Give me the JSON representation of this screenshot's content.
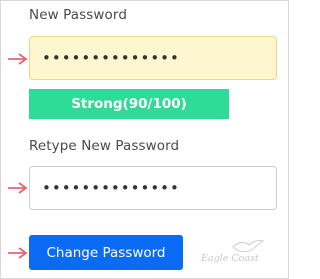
{
  "form": {
    "new_password_label": "New Password",
    "new_password_value": "••••••••••••••",
    "strength_text": "Strong(90/100)",
    "retype_label": "Retype New Password",
    "retype_value": "••••••••••••••",
    "submit_label": "Change Password"
  },
  "strength": {
    "score": 90,
    "max": 100
  },
  "icons": {
    "arrow": "right-arrow-icon",
    "watermark_logo": "eagle-bird-icon"
  },
  "watermark": {
    "text": "Eagle Coast"
  },
  "colors": {
    "arrow": "#e8646e",
    "focused_input_bg": "#fdf6cf",
    "strength_bar": "#2fdc97",
    "button": "#0a6cf5",
    "text": "#4a4a4a"
  }
}
